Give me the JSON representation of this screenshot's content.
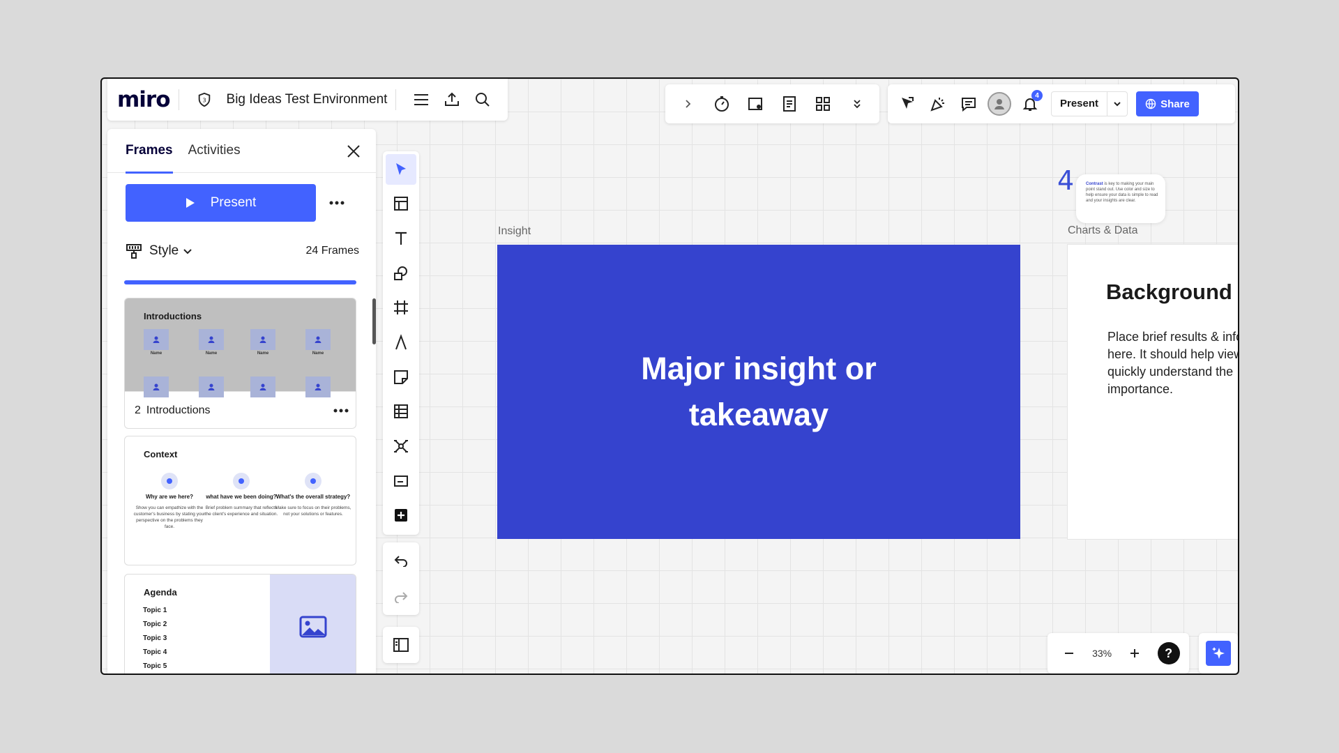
{
  "header": {
    "logo": "miro",
    "board_name": "Big Ideas Test Environment",
    "present_label": "Present",
    "share_label": "Share",
    "notification_count": "4"
  },
  "sidebar": {
    "tabs": [
      {
        "label": "Frames",
        "active": true
      },
      {
        "label": "Activities",
        "active": false
      }
    ],
    "present_label": "Present",
    "style_label": "Style",
    "frame_count": "24 Frames",
    "cards": {
      "intro": {
        "title": "Introductions",
        "number": "2",
        "caption": "Introductions",
        "person_label": "Name"
      },
      "context": {
        "title": "Context",
        "columns": [
          {
            "heading": "Why are we here?",
            "body": "Show you can empathize with the customer's business by stating your perspective on the problems they face."
          },
          {
            "heading": "what have we been doing?",
            "body": "Brief problem summary that reflects the client's experience and situation."
          },
          {
            "heading": "What's the overall strategy?",
            "body": "Make sure to focus on their problems, not your solutions or features."
          }
        ]
      },
      "agenda": {
        "title": "Agenda",
        "topics": [
          "Topic 1",
          "Topic 2",
          "Topic 3",
          "Topic 4",
          "Topic 5"
        ]
      }
    }
  },
  "canvas": {
    "insight_label": "Insight",
    "insight_text": "Major insight or takeaway",
    "charts_label": "Charts & Data",
    "charts_heading": "Background",
    "charts_body": "Place brief results & info here. It should help viewers quickly understand the importance.",
    "sticky_number": "4",
    "sticky_bold": "Contrast",
    "sticky_text": " is key to making your main point stand out. Use color and size to help ensure your data is simple to read and your insights are clear."
  },
  "zoom": {
    "value": "33%",
    "help": "?"
  },
  "colors": {
    "accent": "#4262ff",
    "insight_bg": "#3543ce"
  }
}
